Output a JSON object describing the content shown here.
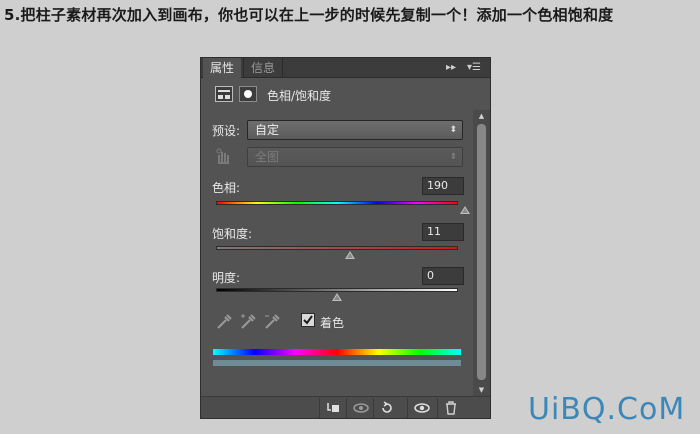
{
  "instruction": "5.把柱子素材再次加入到画布，你也可以在上一步的时候先复制一个！添加一个色相饱和度",
  "panel": {
    "tabs": [
      {
        "label": "属性",
        "active": true
      },
      {
        "label": "信息",
        "active": false
      }
    ],
    "header": {
      "adjustment_icon": "hue-saturation-adjustment-icon",
      "mask_icon": "layer-mask-icon",
      "title": "色相/饱和度"
    },
    "preset": {
      "label": "预设:",
      "value": "自定"
    },
    "channel": {
      "icon": "target-adjustment-hand-icon",
      "value": "全图",
      "disabled": true
    },
    "hue": {
      "label": "色相:",
      "value": "190",
      "min": -180,
      "max": 180
    },
    "saturation": {
      "label": "饱和度:",
      "value": "11",
      "min": -100,
      "max": 100
    },
    "lightness": {
      "label": "明度:",
      "value": "0",
      "min": -100,
      "max": 100
    },
    "eyedroppers": [
      "eyedropper-icon",
      "eyedropper-plus-icon",
      "eyedropper-minus-icon"
    ],
    "colorize": {
      "label": "着色",
      "checked": true
    },
    "footer_buttons": [
      "clip-to-layer-icon",
      "view-previous-state-icon",
      "reset-icon",
      "visibility-eye-icon",
      "trash-icon"
    ]
  },
  "watermark": "UiBQ.CoM",
  "colors": {
    "panel_bg": "#535353",
    "accent": "#3b87b8"
  }
}
